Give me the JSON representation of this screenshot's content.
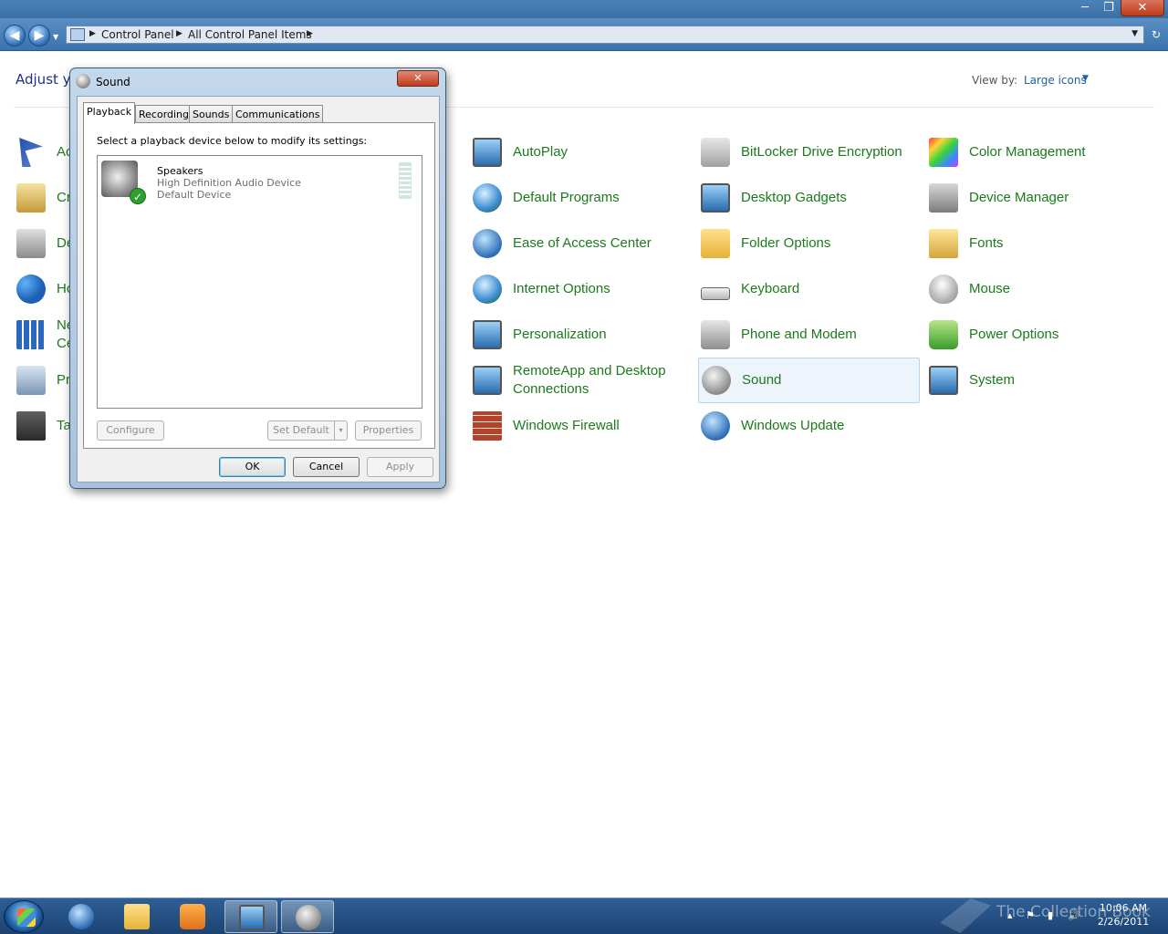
{
  "window": {
    "minimize_glyph": "─",
    "maximize_glyph": "❐",
    "close_glyph": "✕"
  },
  "nav": {
    "back_glyph": "◀",
    "forward_glyph": "▶",
    "breadcrumbs": [
      "Control Panel",
      "All Control Panel Items"
    ],
    "refresh_glyph": "↻"
  },
  "header": {
    "title": "Adjust y",
    "view_by_label": "View by:",
    "view_by_value": "Large icons"
  },
  "items": [
    {
      "label": "AutoPlay",
      "icon": "autoplay-icon"
    },
    {
      "label": "BitLocker Drive Encryption",
      "icon": "bitlocker-icon"
    },
    {
      "label": "Color Management",
      "icon": "color-management-icon"
    },
    {
      "label": "Default Programs",
      "icon": "default-programs-icon"
    },
    {
      "label": "Desktop Gadgets",
      "icon": "desktop-gadgets-icon"
    },
    {
      "label": "Device Manager",
      "icon": "device-manager-icon"
    },
    {
      "label": "Ease of Access Center",
      "icon": "ease-of-access-icon"
    },
    {
      "label": "Folder Options",
      "icon": "folder-options-icon"
    },
    {
      "label": "Fonts",
      "icon": "fonts-icon"
    },
    {
      "label": "Internet Options",
      "icon": "internet-options-icon"
    },
    {
      "label": "Keyboard",
      "icon": "keyboard-icon"
    },
    {
      "label": "Mouse",
      "icon": "mouse-icon"
    },
    {
      "label": "Personalization",
      "icon": "personalization-icon"
    },
    {
      "label": "Phone and Modem",
      "icon": "phone-modem-icon"
    },
    {
      "label": "Power Options",
      "icon": "power-options-icon"
    },
    {
      "label": "RemoteApp and Desktop Connections",
      "icon": "remoteapp-icon"
    },
    {
      "label": "Sound",
      "icon": "sound-icon"
    },
    {
      "label": "System",
      "icon": "system-icon"
    },
    {
      "label": "Windows Firewall",
      "icon": "firewall-icon"
    },
    {
      "label": "Windows Update",
      "icon": "windows-update-icon"
    }
  ],
  "partial_items": [
    {
      "label": "Ac",
      "icon": "action-center-icon"
    },
    {
      "label": "Cr",
      "icon": "credential-manager-icon"
    },
    {
      "label": "De",
      "icon": "devices-printers-icon"
    },
    {
      "label": "Ho",
      "icon": "homegroup-icon"
    },
    {
      "label": "Ne",
      "label2": "Ce",
      "icon": "network-sharing-icon"
    },
    {
      "label": "Pr",
      "icon": "programs-features-icon"
    },
    {
      "label": "Ta",
      "icon": "taskbar-icon"
    }
  ],
  "dialog": {
    "title": "Sound",
    "close_glyph": "✕",
    "tabs": [
      "Playback",
      "Recording",
      "Sounds",
      "Communications"
    ],
    "instruction": "Select a playback device below to modify its settings:",
    "device": {
      "name": "Speakers",
      "description": "High Definition Audio Device",
      "status": "Default Device"
    },
    "check_glyph": "✓",
    "buttons": {
      "configure": "Configure",
      "set_default": "Set Default",
      "split_arrow": "▾",
      "properties": "Properties",
      "ok": "OK",
      "cancel": "Cancel",
      "apply": "Apply"
    }
  },
  "taskbar": {
    "clock_time": "10:06 AM",
    "clock_date": "2/26/2011",
    "watermark": "The Collection Book",
    "tray_chevron": "▴",
    "tray_volume": "🔊"
  },
  "colors": {
    "item_label": "#1b7a1b",
    "heading": "#1e3287",
    "link": "#1e5fa0"
  }
}
